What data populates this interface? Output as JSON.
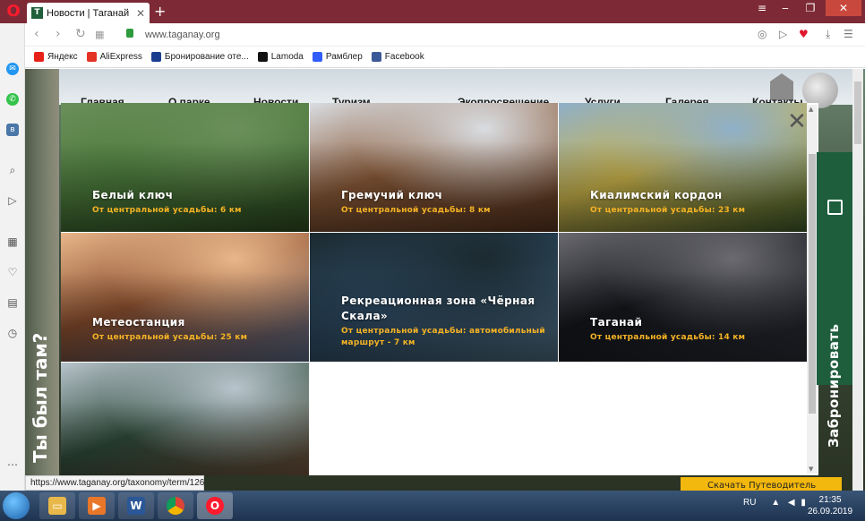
{
  "browser": {
    "tab_title": "Новости | Таганай",
    "url": "www.taganay.org",
    "status_url": "https://www.taganay.org/taxonomy/term/126",
    "bookmarks": [
      {
        "label": "Яндекс",
        "icon": "yandex-icon",
        "color": "#e62117"
      },
      {
        "label": "AliExpress",
        "icon": "aliexpress-icon",
        "color": "#e43225"
      },
      {
        "label": "Бронирование оте...",
        "icon": "booking-icon",
        "color": "#1a3d8f"
      },
      {
        "label": "Lamoda",
        "icon": "lamoda-icon",
        "color": "#111111"
      },
      {
        "label": "Рамблер",
        "icon": "rambler-icon",
        "color": "#315efb"
      },
      {
        "label": "Facebook",
        "icon": "facebook-icon",
        "color": "#3b5998"
      }
    ]
  },
  "site": {
    "nav": [
      "Главная",
      "О парке",
      "Новости",
      "Туризм",
      "Экопросвещение",
      "Услуги",
      "Галерея",
      "Контакты"
    ],
    "left_banner": "Ты был там?",
    "book_button": "Забронировать",
    "promo_text": "Скачать Путеводитель"
  },
  "places": [
    {
      "title": "Белый ключ",
      "distance": "От центральной усадьбы: 6 км",
      "colors": [
        "#4b7a3b",
        "#2f4d22",
        "#6b8f5a"
      ]
    },
    {
      "title": "Гремучий ключ",
      "distance": "От центральной усадьбы: 8 км",
      "colors": [
        "#8a5a38",
        "#5a3520",
        "#d9dde2"
      ]
    },
    {
      "title": "Киалимский кордон",
      "distance": "От центральной усадьбы: 23 км",
      "colors": [
        "#c9b24a",
        "#3f5a2a",
        "#8fb0c9"
      ]
    },
    {
      "title": "Метеостанция",
      "distance": "От центральной усадьбы: 25 км",
      "colors": [
        "#8a4e2e",
        "#5a6a88",
        "#e8b68a"
      ]
    },
    {
      "title": "Рекреационная зона «Чёрная Скала»",
      "distance": "От центральной усадьбы: автомобильный маршрут - 7 км",
      "colors": [
        "#2b4860",
        "#4e6c80",
        "#1c2a30"
      ]
    },
    {
      "title": "Таганай",
      "distance": "От центральной усадьбы: 14 км",
      "colors": [
        "#15171c",
        "#2a2d35",
        "#6a6a70"
      ]
    },
    {
      "title": "",
      "distance": "",
      "colors": [
        "#2f4a3a",
        "#6e4a36",
        "#b8c4cc"
      ]
    }
  ],
  "taskbar": {
    "lang": "RU",
    "time": "21:35",
    "date": "26.09.2019"
  }
}
